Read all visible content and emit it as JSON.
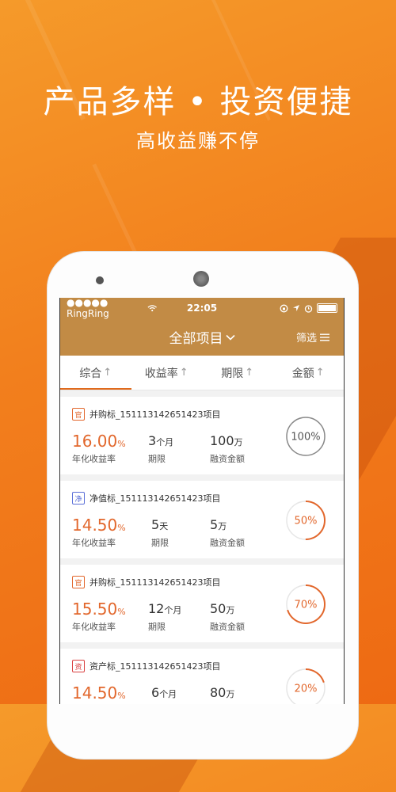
{
  "headline": "产品多样 • 投资便捷",
  "subline": "高收益赚不停",
  "status_bar": {
    "carrier": "●●●●● RingRing",
    "time": "22:05"
  },
  "nav": {
    "title": "全部项目",
    "filter": "筛选"
  },
  "tabs": [
    {
      "label": "综合",
      "arrow": "↑"
    },
    {
      "label": "收益率",
      "arrow": "↑"
    },
    {
      "label": "期限",
      "arrow": "↑"
    },
    {
      "label": "金额",
      "arrow": "↑"
    }
  ],
  "colors": {
    "accent": "#e2672c",
    "header": "#c28b45",
    "ring_full": "#888888",
    "ring_track": "#e6e6e6"
  },
  "label_rate": "年化收益率",
  "label_term": "期限",
  "label_amount": "融资金额",
  "items": [
    {
      "tag": "官",
      "tag_color": "#e2672c",
      "name": "并购标_151113142651423项目",
      "rate": "16.00",
      "pct": "%",
      "term": "3",
      "term_unit": "个月",
      "amount": "100",
      "amount_unit": "万",
      "progress_label": "100%",
      "progress": 1.0
    },
    {
      "tag": "净",
      "tag_color": "#5a6fd8",
      "name": "净值标_151113142651423项目",
      "rate": "14.50",
      "pct": "%",
      "term": "5",
      "term_unit": "天",
      "amount": "5",
      "amount_unit": "万",
      "progress_label": "50%",
      "progress": 0.5
    },
    {
      "tag": "官",
      "tag_color": "#e2672c",
      "name": "并购标_151113142651423项目",
      "rate": "15.50",
      "pct": "%",
      "term": "12",
      "term_unit": "个月",
      "amount": "50",
      "amount_unit": "万",
      "progress_label": "70%",
      "progress": 0.7
    },
    {
      "tag": "资",
      "tag_color": "#d94040",
      "name": "资产标_151113142651423项目",
      "rate": "14.50",
      "pct": "%",
      "term": "6",
      "term_unit": "个月",
      "amount": "80",
      "amount_unit": "万",
      "progress_label": "20%",
      "progress": 0.2
    }
  ]
}
